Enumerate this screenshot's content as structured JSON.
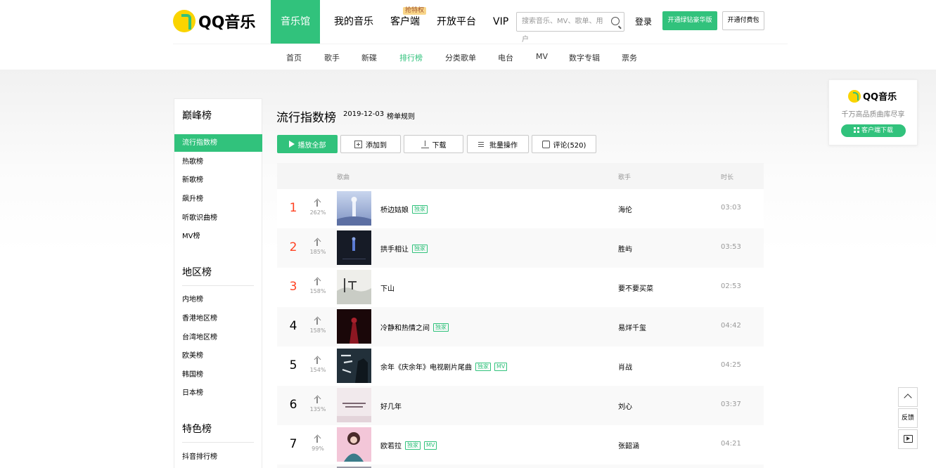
{
  "header": {
    "logo_text": "QQ音乐",
    "nav": [
      {
        "label": "音乐馆",
        "active": true
      },
      {
        "label": "我的音乐"
      },
      {
        "label": "客户端",
        "tag": "抢特权"
      },
      {
        "label": "开放平台"
      },
      {
        "label": "VIP"
      }
    ],
    "search_placeholder": "搜索音乐、MV、歌单、用户",
    "login": "登录",
    "btn_green": "开通绿钻豪华版",
    "btn_outline": "开通付费包"
  },
  "subnav": [
    "首页",
    "歌手",
    "新碟",
    "排行榜",
    "分类歌单",
    "电台",
    "MV",
    "数字专辑",
    "票务"
  ],
  "sidebar": {
    "groups": [
      {
        "title": "巅峰榜",
        "items": [
          "流行指数榜",
          "热歌榜",
          "新歌榜",
          "飙升榜",
          "听歌识曲榜",
          "MV榜"
        ]
      },
      {
        "title": "地区榜",
        "items": [
          "内地榜",
          "香港地区榜",
          "台湾地区榜",
          "欧美榜",
          "韩国榜",
          "日本榜"
        ]
      },
      {
        "title": "特色榜",
        "items": [
          "抖音排行榜"
        ]
      }
    ]
  },
  "main": {
    "title": "流行指数榜",
    "date": "2019-12-03",
    "rule": "榜单规则",
    "actions": [
      "播放全部",
      "添加到",
      "下载",
      "批量操作",
      "评论(520)"
    ],
    "columns": {
      "song": "歌曲",
      "singer": "歌手",
      "duration": "时长"
    },
    "rows": [
      {
        "rank": "1",
        "trend": "262%",
        "song": "桥边姑娘",
        "badges": [
          "独家"
        ],
        "singer": "海伦",
        "duration": "03:03"
      },
      {
        "rank": "2",
        "trend": "185%",
        "song": "拱手相让",
        "badges": [
          "独家"
        ],
        "singer": "胜屿",
        "duration": "03:53"
      },
      {
        "rank": "3",
        "trend": "158%",
        "song": "下山",
        "badges": [],
        "singer": "要不要买菜",
        "duration": "02:53"
      },
      {
        "rank": "4",
        "trend": "158%",
        "song": "冷静和热情之间",
        "badges": [
          "独家"
        ],
        "singer": "易烊千玺",
        "duration": "04:42"
      },
      {
        "rank": "5",
        "trend": "154%",
        "song": "余年《庆余年》电视剧片尾曲",
        "badges": [
          "独家",
          "MV"
        ],
        "singer": "肖战",
        "duration": "04:25"
      },
      {
        "rank": "6",
        "trend": "135%",
        "song": "好几年",
        "badges": [],
        "singer": "刘心",
        "duration": "03:37"
      },
      {
        "rank": "7",
        "trend": "99%",
        "song": "欧若拉",
        "badges": [
          "独家",
          "MV"
        ],
        "singer": "张韶涵",
        "duration": "04:21"
      }
    ]
  },
  "promo": {
    "logo_text": "QQ音乐",
    "slogan": "千万高品质曲库尽享",
    "button": "客户端下载"
  },
  "float": {
    "feedback": "反馈"
  },
  "colors": {
    "accent": "#31c27c",
    "rank_top": "#ff4222"
  }
}
